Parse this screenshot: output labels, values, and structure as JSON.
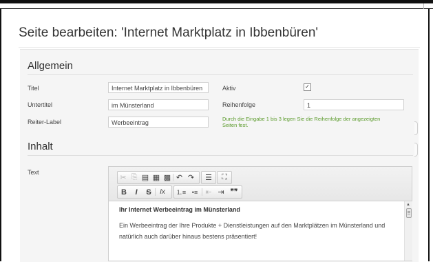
{
  "page": {
    "title": "Seite bearbeiten: 'Internet Marktplatz in Ibbenbüren'"
  },
  "general": {
    "heading": "Allgemein",
    "titel_label": "Titel",
    "titel_value": "Internet Marktplatz in Ibbenbüren",
    "untertitel_label": "Untertitel",
    "untertitel_value": "im Münsterland",
    "reiter_label": "Reiter-Label",
    "reiter_value": "Werbeeintrag",
    "aktiv_label": "Aktiv",
    "aktiv_checked": true,
    "aktiv_glyph": "✓",
    "reihenfolge_label": "Reihenfolge",
    "reihenfolge_value": "1",
    "reihenfolge_hint": "Durch die Eingabe 1 bis 3 legen Sie die Reihenfolge der angezeigten Seiten fest."
  },
  "content_section": {
    "heading": "Inhalt",
    "text_label": "Text"
  },
  "editor": {
    "toolbar_row1": {
      "cut": "✂",
      "copy": "⎘",
      "paste": "▤",
      "paste_text": "▦",
      "paste_word": "▩",
      "undo": "↶",
      "redo": "↷",
      "align": "☰",
      "maximize": "⛶"
    },
    "toolbar_row2": {
      "bold": "B",
      "italic": "I",
      "strike": "S",
      "remove_format": "Ix",
      "numbered_list": "⒈≡",
      "bulleted_list": "•≡",
      "outdent": "⇤",
      "indent": "⇥",
      "blockquote": "❞❞"
    },
    "content": {
      "heading": "Ihr Internet Werbeeintrag im Münsterland",
      "line1": "Ein Werbeeintrag der Ihre Produkte + Dienstleistungen auf den Marktplätzen im Münsterland und",
      "line2": "natürlich auch darüber hinaus bestens präsentiert!"
    },
    "scroll_up_glyph": "▲"
  },
  "colors": {
    "hint_text": "#5a9a2a",
    "panel_bg": "#f5f5f5"
  }
}
